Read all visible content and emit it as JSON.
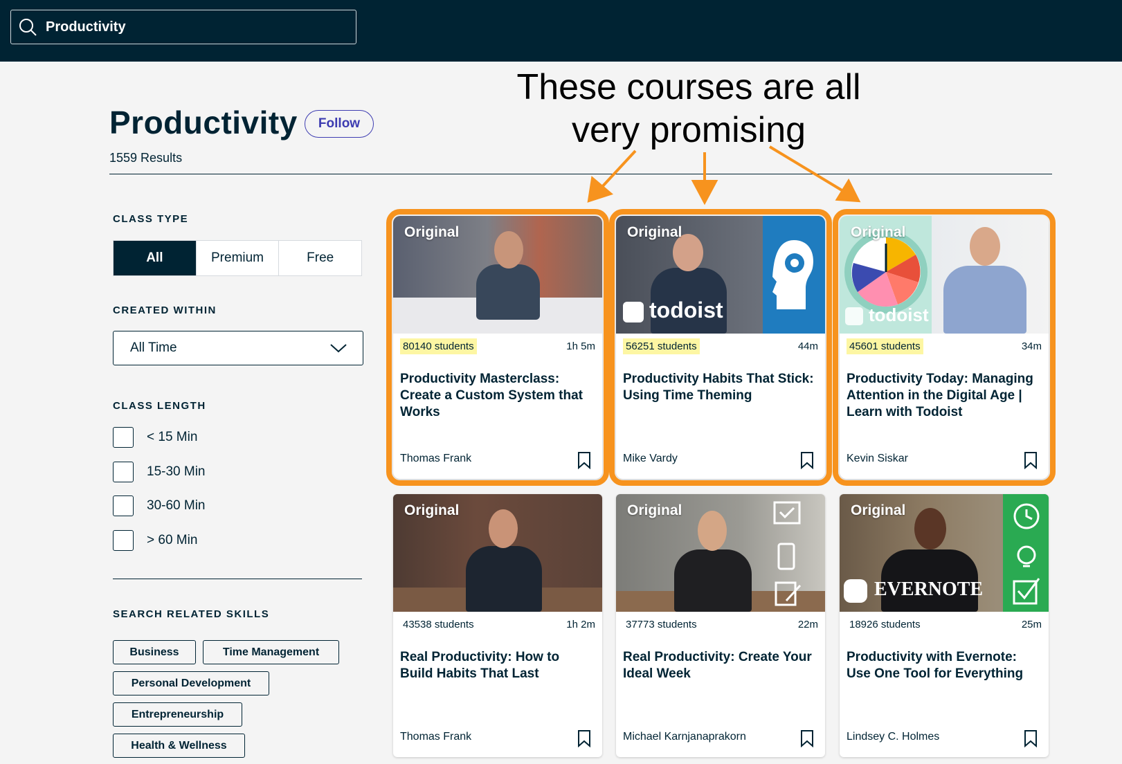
{
  "search": {
    "value": "Productivity"
  },
  "page": {
    "title": "Productivity",
    "follow_label": "Follow",
    "results": "1559 Results"
  },
  "annotation": {
    "line1": "These courses are all",
    "line2": "very promising"
  },
  "filters": {
    "class_type": {
      "heading": "CLASS TYPE",
      "options": [
        "All",
        "Premium",
        "Free"
      ],
      "selected": "All"
    },
    "created_within": {
      "heading": "CREATED WITHIN",
      "value": "All Time"
    },
    "class_length": {
      "heading": "CLASS LENGTH",
      "options": [
        "< 15 Min",
        "15-30 Min",
        "30-60 Min",
        "> 60 Min"
      ]
    },
    "skills": {
      "heading": "SEARCH RELATED SKILLS",
      "items": [
        "Business",
        "Time Management",
        "Personal Development",
        "Entrepreneurship",
        "Health & Wellness"
      ]
    }
  },
  "colors": {
    "navy": "#002333",
    "highlight_orange": "#f7931e",
    "students_highlight": "#fdf6a3",
    "follow_purple": "#3d3cb1"
  },
  "courses": [
    {
      "badge": "Original",
      "students": "80140 students",
      "duration": "1h 5m",
      "title": "Productivity Masterclass: Create a Custom System that Works",
      "teacher": "Thomas Frank",
      "highlighted": true
    },
    {
      "badge": "Original",
      "students": "56251 students",
      "duration": "44m",
      "title": "Productivity Habits That Stick: Using Time Theming",
      "teacher": "Mike Vardy",
      "highlighted": true,
      "thumb_logo": "todoist"
    },
    {
      "badge": "Original",
      "students": "45601 students",
      "duration": "34m",
      "title": "Productivity Today: Managing Attention in the Digital Age | Learn with Todoist",
      "teacher": "Kevin Siskar",
      "highlighted": true,
      "thumb_logo": "todoist"
    },
    {
      "badge": "Original",
      "students": "43538 students",
      "duration": "1h 2m",
      "title": "Real Productivity: How to Build Habits That Last",
      "teacher": "Thomas Frank",
      "highlighted": false
    },
    {
      "badge": "Original",
      "students": "37773 students",
      "duration": "22m",
      "title": "Real Productivity: Create Your Ideal Week",
      "teacher": "Michael Karnjanaprakorn",
      "highlighted": false
    },
    {
      "badge": "Original",
      "students": "18926 students",
      "duration": "25m",
      "title": "Productivity with Evernote: Use One Tool for Everything",
      "teacher": "Lindsey C. Holmes",
      "highlighted": false,
      "thumb_logo": "EVERNOTE"
    }
  ]
}
